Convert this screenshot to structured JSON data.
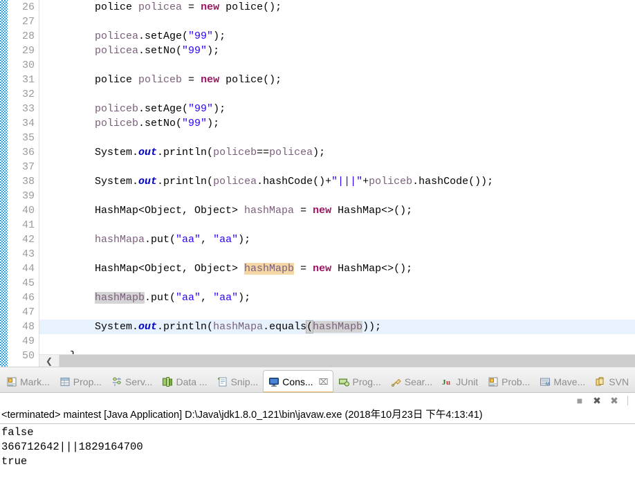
{
  "editor": {
    "first_line_number": 26,
    "lines": [
      {
        "n": 26,
        "text": "        police policea = new police();"
      },
      {
        "n": 27,
        "text": ""
      },
      {
        "n": 28,
        "text": "        policea.setAge(\"99\");"
      },
      {
        "n": 29,
        "text": "        policea.setNo(\"99\");"
      },
      {
        "n": 30,
        "text": ""
      },
      {
        "n": 31,
        "text": "        police policeb = new police();"
      },
      {
        "n": 32,
        "text": ""
      },
      {
        "n": 33,
        "text": "        policeb.setAge(\"99\");"
      },
      {
        "n": 34,
        "text": "        policeb.setNo(\"99\");"
      },
      {
        "n": 35,
        "text": ""
      },
      {
        "n": 36,
        "text": "        System.out.println(policeb==policea);"
      },
      {
        "n": 37,
        "text": ""
      },
      {
        "n": 38,
        "text": "        System.out.println(policea.hashCode()+\"|||\"+policeb.hashCode());"
      },
      {
        "n": 39,
        "text": ""
      },
      {
        "n": 40,
        "text": "        HashMap<Object, Object> hashMapa = new HashMap<>();"
      },
      {
        "n": 41,
        "text": ""
      },
      {
        "n": 42,
        "text": "        hashMapa.put(\"aa\", \"aa\");"
      },
      {
        "n": 43,
        "text": ""
      },
      {
        "n": 44,
        "text": "        HashMap<Object, Object> hashMapb = new HashMap<>();"
      },
      {
        "n": 45,
        "text": ""
      },
      {
        "n": 46,
        "text": "        hashMapb.put(\"aa\", \"aa\");"
      },
      {
        "n": 47,
        "text": ""
      },
      {
        "n": 48,
        "text": "        System.out.println(hashMapa.equals(hashMapb));"
      },
      {
        "n": 49,
        "text": ""
      },
      {
        "n": 50,
        "text": "    }"
      }
    ],
    "cursor_line": 48,
    "scrollbar": {
      "left_arrow": "❮"
    },
    "colors": {
      "keyword": "#9c1160",
      "string": "#2a00ff",
      "field": "#0000c0",
      "local_var": "#7a5f7a",
      "line_number": "#9a9a9a",
      "cursor_line_bg": "#e8f2fe",
      "read_occurrence_bg": "#d4d4d4",
      "write_occurrence_bg": "#f5d6a5",
      "change_bar": "#2e9fd8"
    }
  },
  "bottom_panel": {
    "tabs": [
      {
        "label": "Mark...",
        "icon": "markers-icon",
        "active": false
      },
      {
        "label": "Prop...",
        "icon": "properties-icon",
        "active": false
      },
      {
        "label": "Serv...",
        "icon": "servers-icon",
        "active": false
      },
      {
        "label": "Data ...",
        "icon": "data-source-explorer-icon",
        "active": false
      },
      {
        "label": "Snip...",
        "icon": "snippets-icon",
        "active": false
      },
      {
        "label": "Cons...",
        "icon": "console-icon",
        "active": true,
        "close": "⌧"
      },
      {
        "label": "Prog...",
        "icon": "progress-icon",
        "active": false
      },
      {
        "label": "Sear...",
        "icon": "search-icon",
        "active": false
      },
      {
        "label": "JUnit",
        "icon": "junit-icon",
        "active": false
      },
      {
        "label": "Prob...",
        "icon": "problems-icon",
        "active": false
      },
      {
        "label": "Mave...",
        "icon": "maven-icon",
        "active": false
      },
      {
        "label": "SVN",
        "icon": "svn-icon",
        "active": false
      }
    ],
    "toolbar": [
      {
        "name": "terminate-button",
        "glyph": "■"
      },
      {
        "name": "remove-launch-button",
        "glyph": "✖"
      },
      {
        "name": "remove-all-terminated-button",
        "glyph": "✖"
      }
    ],
    "console": {
      "header": "<terminated> maintest [Java Application] D:\\Java\\jdk1.8.0_121\\bin\\javaw.exe (2018年10月23日 下午4:13:41)",
      "output": [
        "false",
        "366712642|||1829164700",
        "true"
      ]
    }
  }
}
